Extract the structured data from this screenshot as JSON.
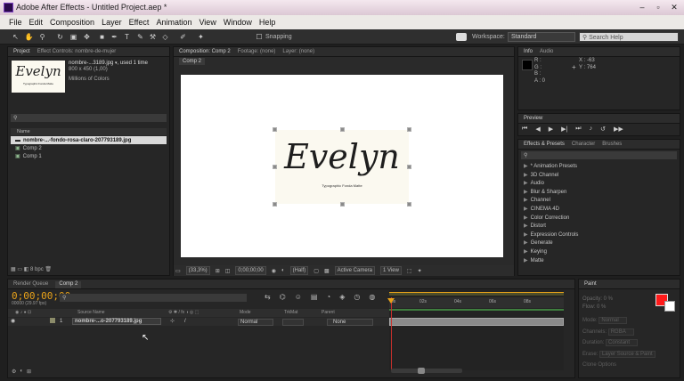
{
  "window": {
    "title": "Adobe After Effects - Untitled Project.aep *",
    "controls": [
      "–",
      "▫",
      "✕"
    ]
  },
  "menu": [
    "File",
    "Edit",
    "Composition",
    "Layer",
    "Effect",
    "Animation",
    "View",
    "Window",
    "Help"
  ],
  "toolbar": {
    "snapping": "Snapping",
    "workspace_label": "Workspace:",
    "workspace_value": "Standard",
    "search_placeholder": "Search Help"
  },
  "project": {
    "tab": "Project",
    "effect_tab": "Effect Controls: nombre-de-mujer",
    "item_name": "nombre-...3189.jpg",
    "item_used": ", used 1 time",
    "item_dims": "800 x 450 (1,00)",
    "item_colors": "Millions of Colors",
    "thumb_text": "Evelyn",
    "thumb_sub": "Typographic Fonda Matte",
    "name_header": "Name",
    "files": [
      "nombre-...-fondo-rosa-claro-207793189.jpg",
      "Comp 2",
      "Comp 1"
    ],
    "bpc": "8 bpc"
  },
  "composition": {
    "tab": "Composition: Comp 2",
    "footage_tab": "Footage: (none)",
    "layer_tab": "Layer: (none)",
    "subtab": "Comp 2",
    "logo_text": "Evelyn",
    "logo_sub": "Typographic Fonda Matte",
    "zoom": "(33,3%)",
    "timecode": "0;00;00;00",
    "resolution": "(Half)",
    "camera": "Active Camera",
    "view": "1 View"
  },
  "info": {
    "tab": "Info",
    "audio_tab": "Audio",
    "r": "R :",
    "g": "G :",
    "b": "B :",
    "a": "A : 0",
    "x": "X : -63",
    "y": "Y : 764"
  },
  "preview": {
    "tab": "Preview"
  },
  "effects": {
    "tab": "Effects & Presets",
    "character_tab": "Character",
    "brushes_tab": "Brushes",
    "items": [
      "* Animation Presets",
      "3D Channel",
      "Audio",
      "Blur & Sharpen",
      "Channel",
      "CINEMA 4D",
      "Color Correction",
      "Distort",
      "Expression Controls",
      "Generate",
      "Keying",
      "Matte"
    ]
  },
  "timeline": {
    "render_tab": "Render Queue",
    "comp_tab": "Comp 2",
    "timecode": "0;00;00;00",
    "fps": "00000 (29.97 fps)",
    "headers": {
      "source": "Source Name",
      "mode": "Mode",
      "trkmat": "TrkMat",
      "parent": "Parent"
    },
    "layer": {
      "num": "1",
      "name": "nombre-...o-207793189.jpg",
      "mode": "Normal",
      "parent": "None"
    },
    "ruler": [
      "0s",
      "02s",
      "04s",
      "06s",
      "08s"
    ]
  },
  "paint": {
    "tab": "Paint",
    "opacity": "Opacity: 0 %",
    "flow": "Flow: 0 %",
    "mode": "Mode:",
    "mode_val": "Normal",
    "channels": "Channels:",
    "channels_val": "RGBA",
    "duration": "Duration:",
    "duration_val": "Constant",
    "erase": "Erase:",
    "erase_val": "Layer Source & Paint",
    "clone": "Clone Options"
  },
  "colors": {
    "accent_orange": "#e8a21a",
    "playhead": "#c9302c",
    "paint_red": "#ff1a1a"
  }
}
